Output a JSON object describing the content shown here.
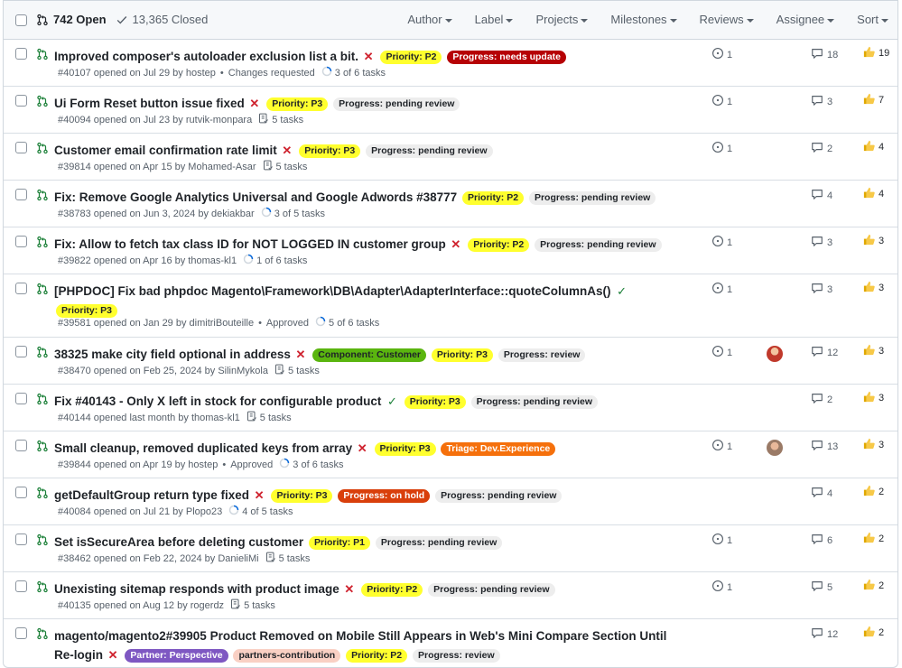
{
  "header": {
    "open_label": "742 Open",
    "closed_label": "13,365 Closed",
    "filters": [
      "Author",
      "Label",
      "Projects",
      "Milestones",
      "Reviews",
      "Assignee",
      "Sort"
    ]
  },
  "colors": {
    "priority_p1": "#ffff2e",
    "priority_p2": "#ffff2e",
    "priority_p3": "#ffff2e",
    "needs_update": "#b60205",
    "pending_review": "#ededed",
    "review": "#ededed",
    "component_customer": "#5ab50f",
    "triage": "#f5700c",
    "on_hold": "#d93f0b",
    "partner_perspective": "#7e57c2",
    "partners_contribution": "#f9d0c4"
  },
  "rows": [
    {
      "title": "Improved composer's autoloader exclusion list a bit.",
      "status": "✕",
      "labels": [
        "Priority: P2",
        "Progress: needs update"
      ],
      "number": "#40107",
      "opened": "opened on Jul 29 by hostep",
      "review": "Changes requested",
      "tasks": "3 of 6 tasks",
      "issues": "1",
      "comments": "18",
      "thumbs": "19"
    },
    {
      "title": "Ui Form Reset button issue fixed",
      "status": "✕",
      "labels": [
        "Priority: P3",
        "Progress: pending review"
      ],
      "number": "#40094",
      "opened": "opened on Jul 23 by rutvik-monpara",
      "review": "",
      "tasks": "5 tasks",
      "issues": "1",
      "comments": "3",
      "thumbs": "7"
    },
    {
      "title": "Customer email confirmation rate limit",
      "status": "✕",
      "labels": [
        "Priority: P3",
        "Progress: pending review"
      ],
      "number": "#39814",
      "opened": "opened on Apr 15 by Mohamed-Asar",
      "review": "",
      "tasks": "5 tasks",
      "issues": "1",
      "comments": "2",
      "thumbs": "4"
    },
    {
      "title": "Fix: Remove Google Analytics Universal and Google Adwords #38777",
      "status": "",
      "labels": [
        "Priority: P2",
        "Progress: pending review"
      ],
      "number": "#38783",
      "opened": "opened on Jun 3, 2024 by dekiakbar",
      "review": "",
      "tasks": "3 of 5 tasks",
      "issues": "",
      "comments": "4",
      "thumbs": "4"
    },
    {
      "title": "Fix: Allow to fetch tax class ID for NOT LOGGED IN customer group",
      "status": "✕",
      "labels": [
        "Priority: P2",
        "Progress: pending review"
      ],
      "number": "#39822",
      "opened": "opened on Apr 16 by thomas-kl1",
      "review": "",
      "tasks": "1 of 6 tasks",
      "issues": "1",
      "comments": "3",
      "thumbs": "3"
    },
    {
      "title": "[PHPDOC] Fix bad phpdoc Magento\\Framework\\DB\\Adapter\\AdapterInterface::quoteColumnAs()",
      "status": "✓",
      "labels": [
        "Priority: P3"
      ],
      "number": "#39581",
      "opened": "opened on Jan 29 by dimitriBouteille",
      "review": "Approved",
      "tasks": "5 of 6 tasks",
      "issues": "1",
      "comments": "3",
      "thumbs": "3"
    },
    {
      "title": "38325 make city field optional in address",
      "status": "✕",
      "labels": [
        "Component: Customer",
        "Priority: P3",
        "Progress: review"
      ],
      "number": "#38470",
      "opened": "opened on Feb 25, 2024 by SilinMykola",
      "review": "",
      "tasks": "5 tasks",
      "issues": "1",
      "comments": "12",
      "thumbs": "3"
    },
    {
      "title": "Fix #40143 - Only X left in stock for configurable product",
      "status": "✓",
      "labels": [
        "Priority: P3",
        "Progress: pending review"
      ],
      "number": "#40144",
      "opened": "opened last month by thomas-kl1",
      "review": "",
      "tasks": "5 tasks",
      "issues": "",
      "comments": "2",
      "thumbs": "3"
    },
    {
      "title": "Small cleanup, removed duplicated keys from array",
      "status": "✕",
      "labels": [
        "Priority: P3",
        "Triage: Dev.Experience"
      ],
      "number": "#39844",
      "opened": "opened on Apr 19 by hostep",
      "review": "Approved",
      "tasks": "3 of 6 tasks",
      "issues": "1",
      "comments": "13",
      "thumbs": "3"
    },
    {
      "title": "getDefaultGroup return type fixed",
      "status": "✕",
      "labels": [
        "Priority: P3",
        "Progress: on hold",
        "Progress: pending review"
      ],
      "number": "#40084",
      "opened": "opened on Jul 21 by Plopo23",
      "review": "",
      "tasks": "4 of 5 tasks",
      "issues": "",
      "comments": "4",
      "thumbs": "2"
    },
    {
      "title": "Set isSecureArea before deleting customer",
      "status": "",
      "labels": [
        "Priority: P1",
        "Progress: pending review"
      ],
      "number": "#38462",
      "opened": "opened on Feb 22, 2024 by DanieliMi",
      "review": "",
      "tasks": "5 tasks",
      "issues": "1",
      "comments": "6",
      "thumbs": "2"
    },
    {
      "title": "Unexisting sitemap responds with product image",
      "status": "✕",
      "labels": [
        "Priority: P2",
        "Progress: pending review"
      ],
      "number": "#40135",
      "opened": "opened on Aug 12 by rogerdz",
      "review": "",
      "tasks": "5 tasks",
      "issues": "1",
      "comments": "5",
      "thumbs": "2"
    },
    {
      "title": "magento/magento2#39905 Product Removed on Mobile Still Appears in Web's Mini Compare Section Until Re-login",
      "status": "✕",
      "labels": [
        "Partner: Perspective",
        "partners-contribution",
        "Priority: P2",
        "Progress: review"
      ],
      "number": "",
      "opened": "",
      "review": "",
      "tasks": "",
      "issues": "",
      "comments": "12",
      "thumbs": "2"
    }
  ]
}
